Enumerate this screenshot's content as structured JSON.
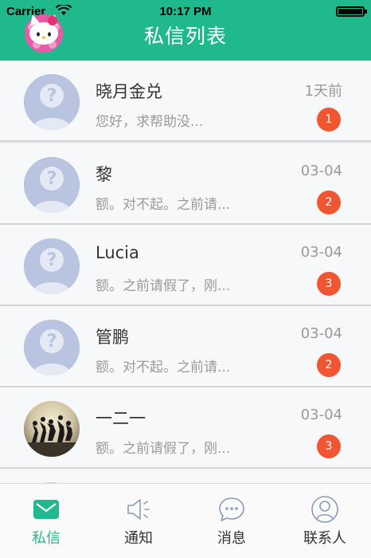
{
  "statusbar": {
    "carrier": "Carrier",
    "time": "10:17 PM"
  },
  "header": {
    "title": "私信列表"
  },
  "messages": [
    {
      "name": "晓月金兑",
      "preview": "您好，求帮助没...",
      "date": "1天前",
      "unread": "1",
      "avatar": "default-avatar"
    },
    {
      "name": "黎",
      "preview": "额。对不起。之前请...",
      "date": "03-04",
      "unread": "2",
      "avatar": "default-avatar"
    },
    {
      "name": "Lucia",
      "preview": "额。之前请假了，刚...",
      "date": "03-04",
      "unread": "3",
      "avatar": "default-avatar"
    },
    {
      "name": "管鹏",
      "preview": "额。对不起。之前请...",
      "date": "03-04",
      "unread": "2",
      "avatar": "default-avatar"
    },
    {
      "name": "一二一",
      "preview": "额。之前请假了，刚...",
      "date": "03-04",
      "unread": "3",
      "avatar": "photo-avatar"
    }
  ],
  "tabs": [
    {
      "label": "私信",
      "icon": "mail-icon",
      "active": true
    },
    {
      "label": "通知",
      "icon": "megaphone-icon",
      "active": false
    },
    {
      "label": "消息",
      "icon": "chat-bubble-icon",
      "active": false
    },
    {
      "label": "联系人",
      "icon": "contact-icon",
      "active": false
    }
  ],
  "colors": {
    "accent": "#20b98d",
    "badge": "#f15632"
  }
}
